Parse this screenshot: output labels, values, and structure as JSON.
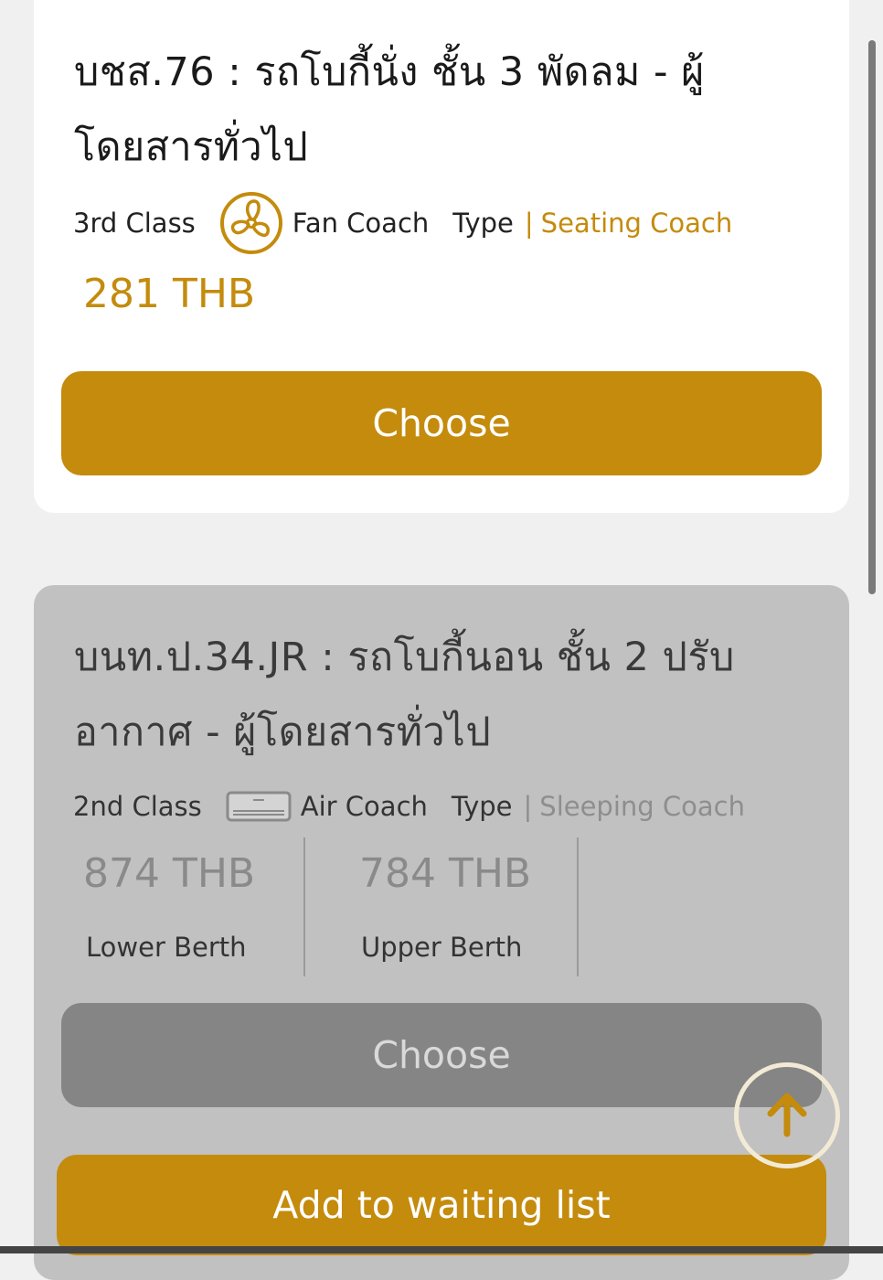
{
  "card1": {
    "title": "บชส.76 : รถโบกี้นั่ง ชั้น 3 พัดลม - ผู้โดยสารทั่วไป",
    "class_label": "3rd Class",
    "coach_icon": "fan-icon",
    "coach_label": "Fan Coach",
    "type_label": "Type",
    "separator": "|",
    "type_value": "Seating Coach",
    "price": "281 THB",
    "choose_label": "Choose"
  },
  "card2": {
    "title": "บนท.ป.34.JR : รถโบกี้นอน ชั้น 2 ปรับอากาศ - ผู้โดยสารทั่วไป",
    "class_label": "2nd Class",
    "coach_icon": "air-conditioner-icon",
    "coach_label": "Air Coach",
    "type_label": "Type",
    "separator": "|",
    "type_value": "Sleeping Coach",
    "berths": [
      {
        "price": "874 THB",
        "label": "Lower Berth"
      },
      {
        "price": "784 THB",
        "label": "Upper Berth"
      }
    ],
    "choose_label": "Choose",
    "waiting_label": "Add to waiting list"
  },
  "scroll_top_icon": "arrow-up-icon",
  "colors": {
    "accent": "#c48b0c",
    "disabled_card": "#c1c1c1",
    "disabled_button": "#858585",
    "background": "#f0f0f0"
  }
}
